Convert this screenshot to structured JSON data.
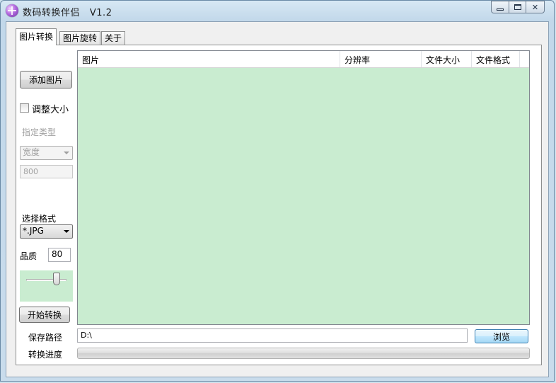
{
  "window": {
    "title": "数码转换伴侣   V1.2",
    "minimize_label": "minimize",
    "maximize_label": "maximize",
    "close_label": "close"
  },
  "tabs": [
    {
      "label": "图片转换",
      "active": true
    },
    {
      "label": "图片旋转",
      "active": false
    },
    {
      "label": "关于",
      "active": false
    }
  ],
  "left_panel": {
    "add_image_button": "添加图片",
    "resize_checkbox_label": "调整大小",
    "resize_checked": false,
    "specify_type_label": "指定类型",
    "dimension_select_value": "宽度",
    "size_value": "800",
    "select_format_label": "选择格式",
    "format_select_value": "*.JPG",
    "quality_label": "品质",
    "quality_value": "80",
    "quality_slider_fraction": 0.8,
    "start_convert_button": "开始转换"
  },
  "list": {
    "columns": [
      "图片",
      "分辨率",
      "文件大小",
      "文件格式"
    ],
    "rows": []
  },
  "bottom": {
    "save_path_label": "保存路径",
    "save_path_value": "D:\\",
    "browse_button": "浏览",
    "progress_label": "转换进度",
    "progress_fraction": 0
  },
  "colors": {
    "list_background": "#c9ecd0",
    "window_frame": "#c2d8ea",
    "accent_button": "#a7d9f5"
  }
}
